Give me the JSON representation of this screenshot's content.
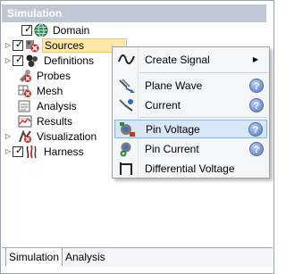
{
  "panel": {
    "title": "Simulation"
  },
  "tree": {
    "items": [
      {
        "label": "Domain",
        "checked": true,
        "icon": "globe-icon",
        "expander": false
      },
      {
        "label": "Sources",
        "checked": true,
        "icon": "sources-icon",
        "expander": true,
        "selected": true
      },
      {
        "label": "Definitions",
        "checked": true,
        "icon": "definitions-icon",
        "expander": true
      },
      {
        "label": "Probes",
        "icon": "probes-icon"
      },
      {
        "label": "Mesh",
        "icon": "mesh-icon"
      },
      {
        "label": "Analysis",
        "icon": "analysis-icon"
      },
      {
        "label": "Results",
        "icon": "results-icon"
      },
      {
        "label": "Visualization",
        "icon": "visualization-icon",
        "expander": true
      },
      {
        "label": "Harness",
        "checked": true,
        "icon": "harness-icon",
        "expander": true
      }
    ]
  },
  "context_menu": {
    "items": [
      {
        "label": "Create Signal",
        "icon": "signal-wave-icon",
        "submenu": true
      },
      {
        "label": "Plane Wave",
        "icon": "plane-wave-icon",
        "help": true
      },
      {
        "label": "Current",
        "icon": "current-icon",
        "help": true
      },
      {
        "label": "Pin Voltage",
        "icon": "pin-voltage-icon",
        "help": true,
        "highlighted": true
      },
      {
        "label": "Pin Current",
        "icon": "pin-current-icon",
        "help": true
      },
      {
        "label": "Differential Voltage",
        "icon": "differential-voltage-icon"
      }
    ],
    "help_glyph": "?",
    "submenu_glyph": "▶"
  },
  "tabs": [
    {
      "label": "Simulation",
      "active": true
    },
    {
      "label": "Analysis",
      "active": false
    }
  ],
  "glyphs": {
    "expander": "▷",
    "check": "✓"
  },
  "colors": {
    "title_bar": "#bfc7d4",
    "selection": "#ffe8a6",
    "menu_hover": "#d9e6f7",
    "help_icon": "#5a7fc7"
  }
}
